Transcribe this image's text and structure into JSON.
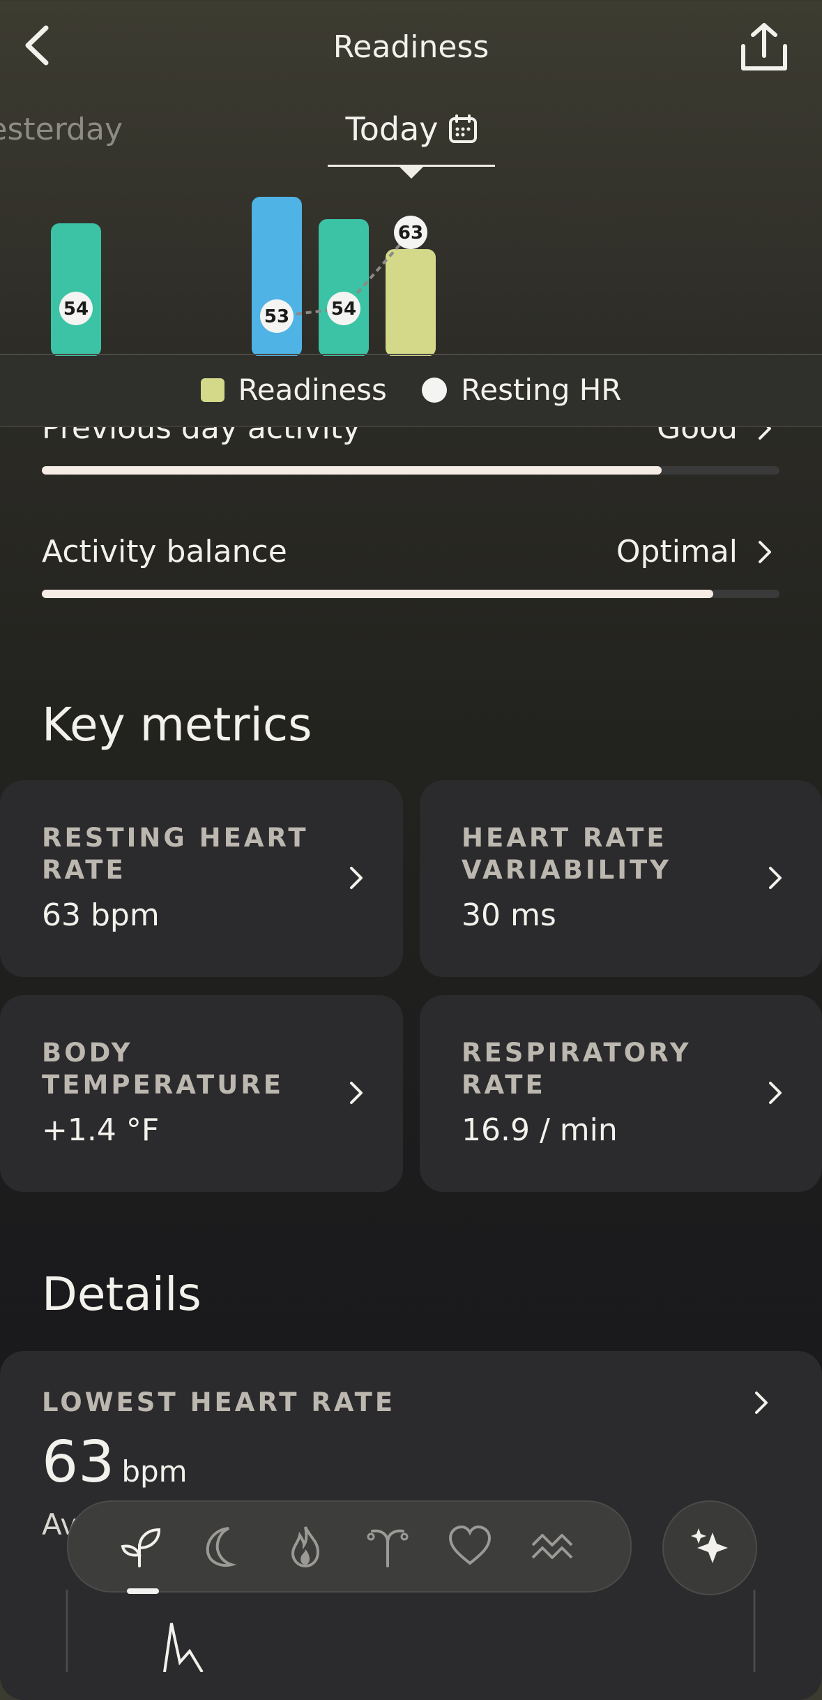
{
  "header": {
    "title": "Readiness"
  },
  "day_tabs": {
    "previous": "Yesterday",
    "current": "Today"
  },
  "chart_data": {
    "type": "bar",
    "series": [
      {
        "name": "Readiness",
        "values": [
          54,
          null,
          null,
          54,
          63
        ]
      },
      {
        "name": "Resting HR",
        "values": [
          null,
          null,
          53,
          54,
          63
        ]
      }
    ],
    "bar_labels": [
      {
        "index": 0,
        "value": "54"
      },
      {
        "index": 2,
        "value": "53"
      },
      {
        "index": 3,
        "value": "54"
      },
      {
        "index": 4,
        "value": "63"
      }
    ],
    "colors": {
      "readiness_today": "#d4d98a",
      "readiness_past": "#3cc3a5",
      "highlight": "#4fb3e6",
      "resting_hr": "#f4f4f2"
    }
  },
  "legend": {
    "readiness": "Readiness",
    "resting_hr": "Resting HR"
  },
  "contributors": [
    {
      "label": "Previous day activity",
      "value": "Good",
      "progress": 0.84
    },
    {
      "label": "Activity balance",
      "value": "Optimal",
      "progress": 0.91
    }
  ],
  "key_metrics": {
    "title": "Key metrics",
    "cards": [
      {
        "label_line1": "RESTING HEART",
        "label_line2": "RATE",
        "value": "63 bpm"
      },
      {
        "label_line1": "HEART RATE",
        "label_line2": "VARIABILITY",
        "value": "30 ms"
      },
      {
        "label_line1": "BODY",
        "label_line2": "TEMPERATURE",
        "value": "+1.4 °F"
      },
      {
        "label_line1": "RESPIRATORY",
        "label_line2": "RATE",
        "value": "16.9 / min"
      }
    ]
  },
  "details": {
    "title": "Details",
    "lowest_hr": {
      "label": "LOWEST HEART RATE",
      "value": "63",
      "unit": "bpm",
      "sub": "Av"
    }
  },
  "nav": {
    "tabs": [
      "sprout-icon",
      "moon-icon",
      "flame-icon",
      "womens-health-icon",
      "heart-icon",
      "stress-icon"
    ],
    "active": 0,
    "fab_icon": "sparkles-icon"
  }
}
